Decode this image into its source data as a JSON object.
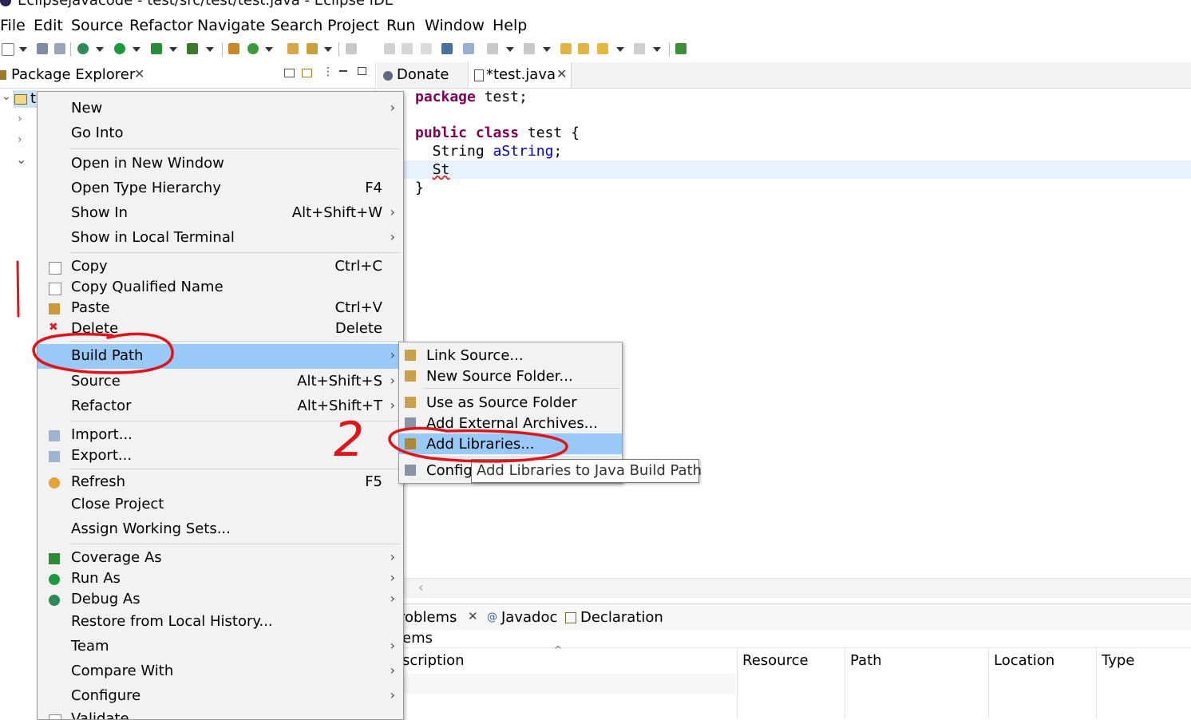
{
  "window": {
    "title": "Eclipsejavacode - test/src/test/test.java - Eclipse IDE"
  },
  "menubar": [
    {
      "label": "File"
    },
    {
      "label": "Edit"
    },
    {
      "label": "Source"
    },
    {
      "label": "Refactor"
    },
    {
      "label": "Navigate"
    },
    {
      "label": "Search"
    },
    {
      "label": "Project"
    },
    {
      "label": "Run"
    },
    {
      "label": "Window"
    },
    {
      "label": "Help"
    }
  ],
  "package_explorer": {
    "tab_label": "Package Explorer",
    "project_label": "t"
  },
  "editor": {
    "tabs": [
      {
        "label": "Donate"
      },
      {
        "label": "*test.java"
      }
    ],
    "code_lines": [
      "package test;",
      "",
      "public class test {",
      "    String aString;",
      "    St",
      "}"
    ]
  },
  "bottom_panel": {
    "tabs": [
      {
        "label": "roblems"
      },
      {
        "label": "Javadoc"
      },
      {
        "label": "Declaration"
      }
    ],
    "subtitle": "ems",
    "columns": [
      "scription",
      "Resource",
      "Path",
      "Location",
      "Type"
    ]
  },
  "context_menu": {
    "items": [
      {
        "label": "New",
        "shortcut": "",
        "submenu": true
      },
      {
        "label": "Go Into",
        "shortcut": "",
        "submenu": false
      },
      {
        "label": "Open in New Window",
        "shortcut": "",
        "submenu": false
      },
      {
        "label": "Open Type Hierarchy",
        "shortcut": "F4",
        "submenu": false
      },
      {
        "label": "Show In",
        "shortcut": "Alt+Shift+W",
        "submenu": true
      },
      {
        "label": "Show in Local Terminal",
        "shortcut": "",
        "submenu": true
      },
      {
        "label": "Copy",
        "shortcut": "Ctrl+C",
        "submenu": false
      },
      {
        "label": "Copy Qualified Name",
        "shortcut": "",
        "submenu": false
      },
      {
        "label": "Paste",
        "shortcut": "Ctrl+V",
        "submenu": false
      },
      {
        "label": "Delete",
        "shortcut": "Delete",
        "submenu": false
      },
      {
        "label": "Build Path",
        "shortcut": "",
        "submenu": true
      },
      {
        "label": "Source",
        "shortcut": "Alt+Shift+S",
        "submenu": true
      },
      {
        "label": "Refactor",
        "shortcut": "Alt+Shift+T",
        "submenu": true
      },
      {
        "label": "Import...",
        "shortcut": "",
        "submenu": false
      },
      {
        "label": "Export...",
        "shortcut": "",
        "submenu": false
      },
      {
        "label": "Refresh",
        "shortcut": "F5",
        "submenu": false
      },
      {
        "label": "Close Project",
        "shortcut": "",
        "submenu": false
      },
      {
        "label": "Assign Working Sets...",
        "shortcut": "",
        "submenu": false
      },
      {
        "label": "Coverage As",
        "shortcut": "",
        "submenu": true
      },
      {
        "label": "Run As",
        "shortcut": "",
        "submenu": true
      },
      {
        "label": "Debug As",
        "shortcut": "",
        "submenu": true
      },
      {
        "label": "Restore from Local History...",
        "shortcut": "",
        "submenu": false
      },
      {
        "label": "Team",
        "shortcut": "",
        "submenu": true
      },
      {
        "label": "Compare With",
        "shortcut": "",
        "submenu": true
      },
      {
        "label": "Configure",
        "shortcut": "",
        "submenu": true
      },
      {
        "label": "Validate",
        "shortcut": "",
        "submenu": false
      }
    ]
  },
  "build_path_submenu": {
    "items": [
      {
        "label": "Link Source..."
      },
      {
        "label": "New Source Folder..."
      },
      {
        "label": "Use as Source Folder"
      },
      {
        "label": "Add External Archives..."
      },
      {
        "label": "Add Libraries..."
      },
      {
        "label": "Config"
      }
    ]
  },
  "tooltip": {
    "text": "Add Libraries to Java Build Path"
  },
  "annotations": {
    "step2_label": "2",
    "highlight_color": "#e0141b"
  },
  "colors": {
    "menu_highlight": "#99c9f7",
    "keyword": "#7f0055",
    "field": "#0000c0"
  }
}
